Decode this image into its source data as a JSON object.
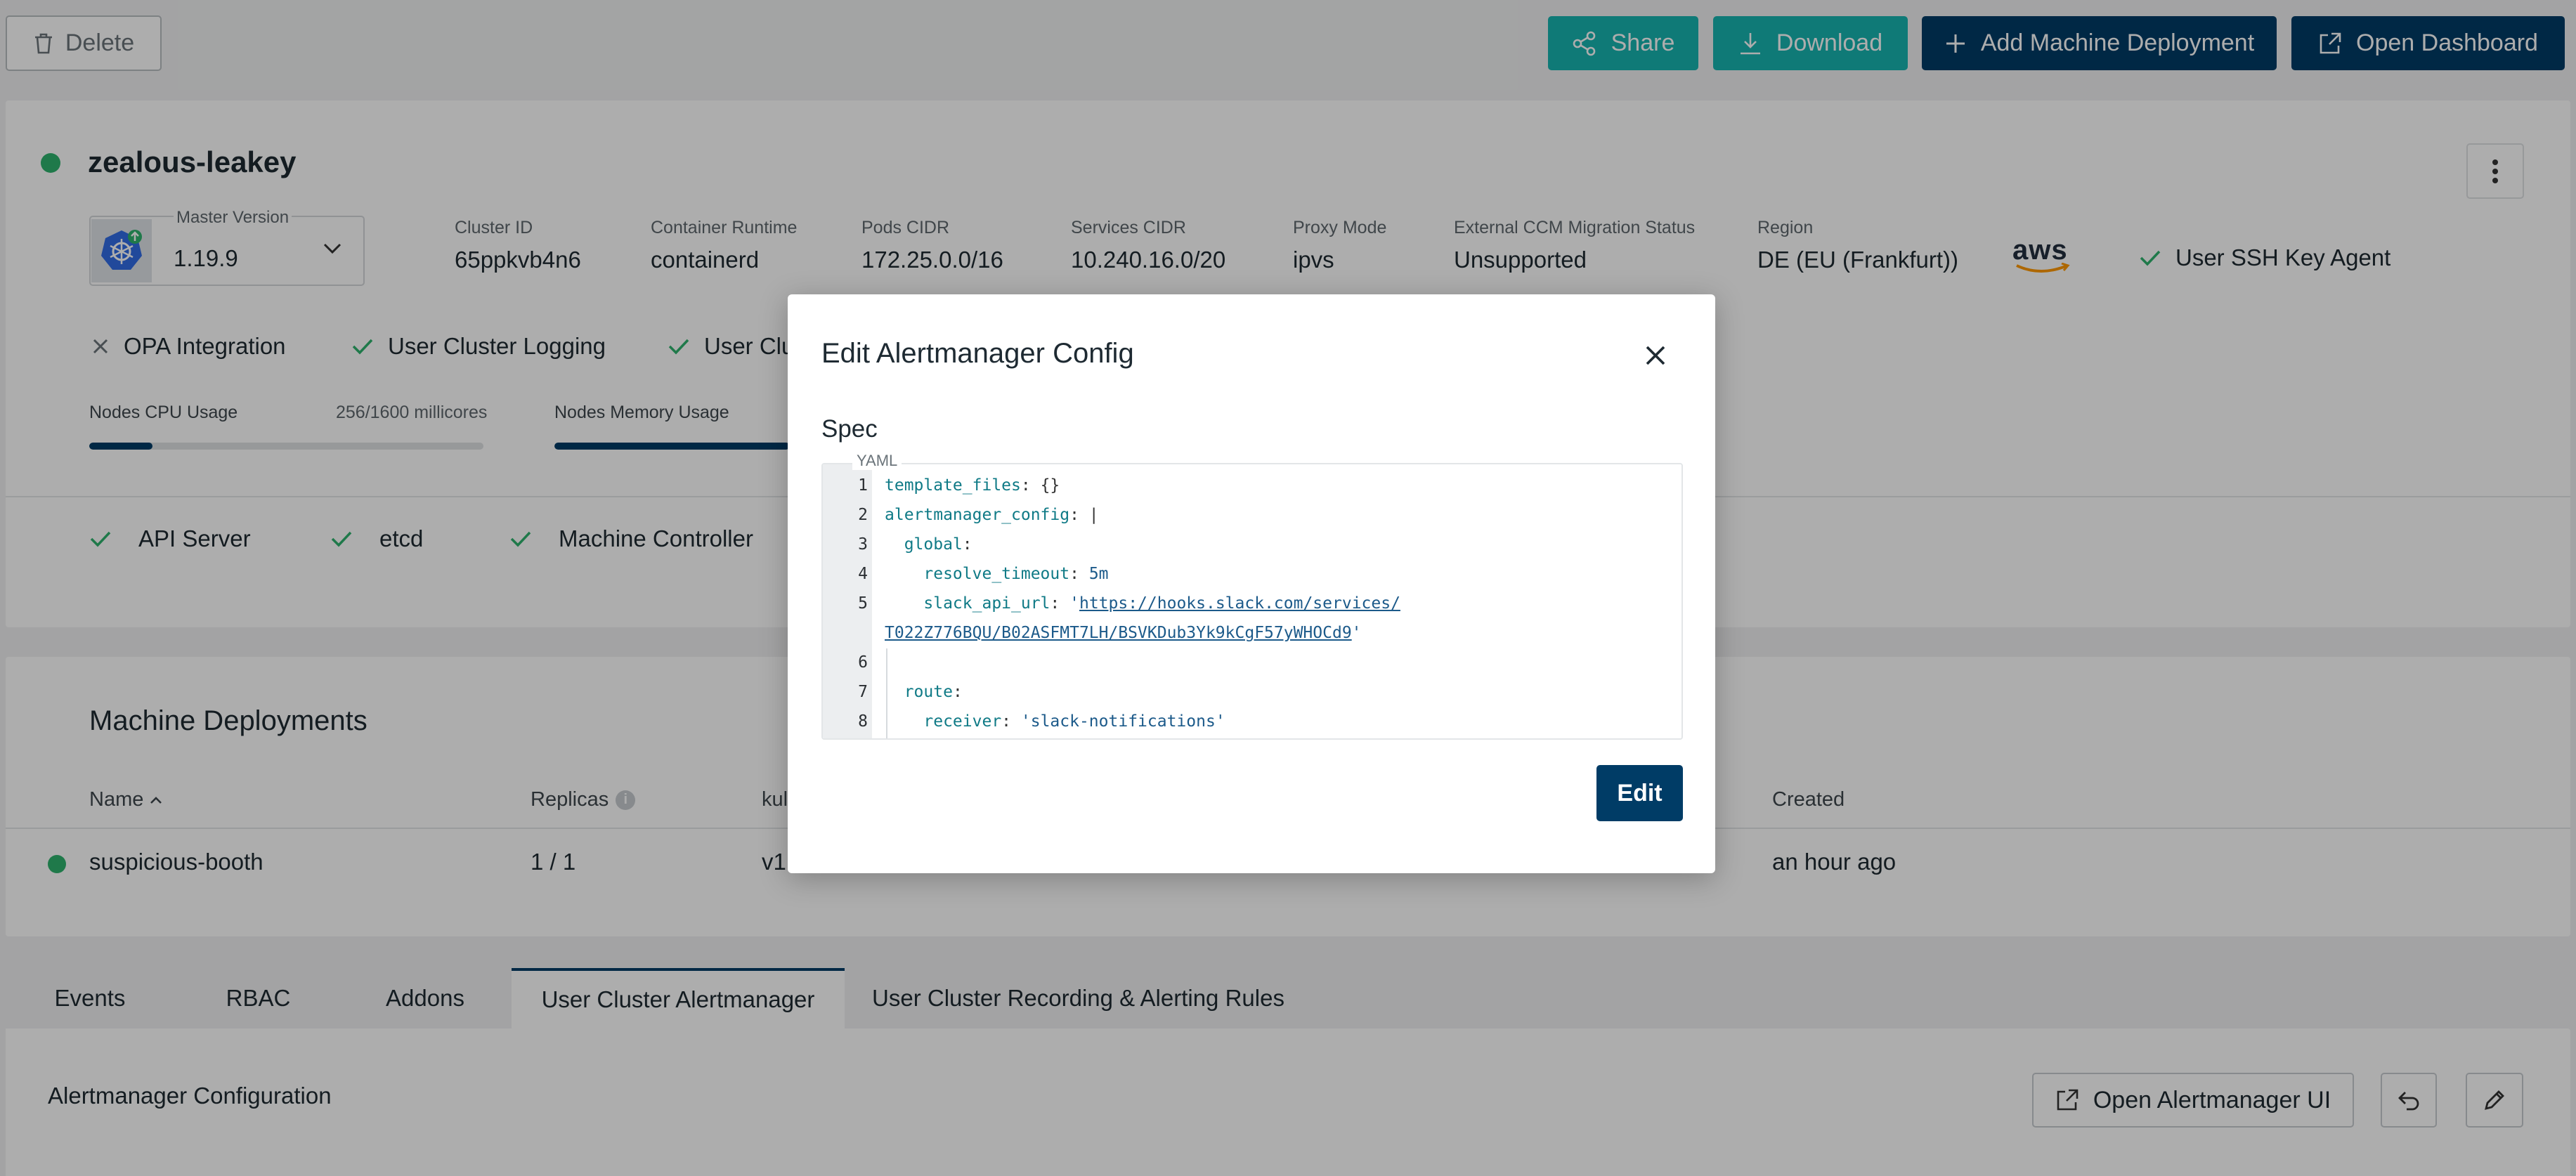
{
  "toolbar": {
    "delete_label": "Delete",
    "share_label": "Share",
    "download_label": "Download",
    "add_md_label": "Add Machine Deployment",
    "open_dashboard_label": "Open Dashboard"
  },
  "cluster": {
    "name": "zealous-leakey",
    "status_color": "#2fb36d",
    "master_version_label": "Master Version",
    "master_version": "1.19.9",
    "fields": [
      {
        "label": "Cluster ID",
        "value": "65ppkvb4n6"
      },
      {
        "label": "Container Runtime",
        "value": "containerd"
      },
      {
        "label": "Pods CIDR",
        "value": "172.25.0.0/16"
      },
      {
        "label": "Services CIDR",
        "value": "10.240.16.0/20"
      },
      {
        "label": "Proxy Mode",
        "value": "ipvs"
      },
      {
        "label": "External CCM Migration Status",
        "value": "Unsupported"
      },
      {
        "label": "Region",
        "value": "DE (EU (Frankfurt))"
      }
    ],
    "provider_logo": "aws",
    "ssh_agent_label": "User SSH Key Agent",
    "features": [
      {
        "label": "OPA Integration",
        "icon": "close-icon"
      },
      {
        "label": "User Cluster Logging",
        "icon": "check-icon"
      },
      {
        "label": "User Clu",
        "icon": "check-icon"
      }
    ],
    "cpu_usage_label": "Nodes CPU Usage",
    "cpu_usage_value": "256/1600 millicores",
    "cpu_usage_fraction": 0.16,
    "memory_usage_label": "Nodes Memory Usage",
    "memory_usage_fraction": 1.0,
    "health": [
      "API Server",
      "etcd",
      "Machine Controller"
    ]
  },
  "machine_deployments": {
    "title": "Machine Deployments",
    "columns": {
      "name": "Name",
      "replicas": "Replicas",
      "kubelet": "kul",
      "created": "Created"
    },
    "rows": [
      {
        "name": "suspicious-booth",
        "replicas": "1 / 1",
        "kubelet": "v1",
        "created": "an hour ago",
        "status_color": "#2fb36d"
      }
    ]
  },
  "tabs": [
    {
      "label": "Events",
      "active": false
    },
    {
      "label": "RBAC",
      "active": false
    },
    {
      "label": "Addons",
      "active": false
    },
    {
      "label": "User Cluster Alertmanager",
      "active": true
    },
    {
      "label": "User Cluster Recording & Alerting Rules",
      "active": false
    }
  ],
  "alertmanager": {
    "title": "Alertmanager Configuration",
    "open_ui_label": "Open Alertmanager UI"
  },
  "modal": {
    "title": "Edit Alertmanager Config",
    "spec_label": "Spec",
    "editor_language": "YAML",
    "line_numbers": [
      "1",
      "2",
      "3",
      "4",
      "5",
      "6",
      "7",
      "8"
    ],
    "code": {
      "l1_key": "template_files",
      "l1_rest": ": {}",
      "l2_key": "alertmanager_config",
      "l2_rest": ": |",
      "l3_key": "global",
      "l4_key": "resolve_timeout",
      "l4_val": "5m",
      "l5_key": "slack_api_url",
      "l5_url_a": "https://hooks.slack.com/services/",
      "l5_url_b": "T022Z776BQU/B02ASFMT7LH/BSVKDub3Yk9kCgF57yWHOCd9",
      "l7_key": "route",
      "l8_key": "receiver",
      "l8_val": "'slack-notifications'"
    },
    "edit_label": "Edit"
  },
  "colors": {
    "teal": "#17b4b0",
    "navy": "#003c66",
    "success": "#2fb36d"
  }
}
